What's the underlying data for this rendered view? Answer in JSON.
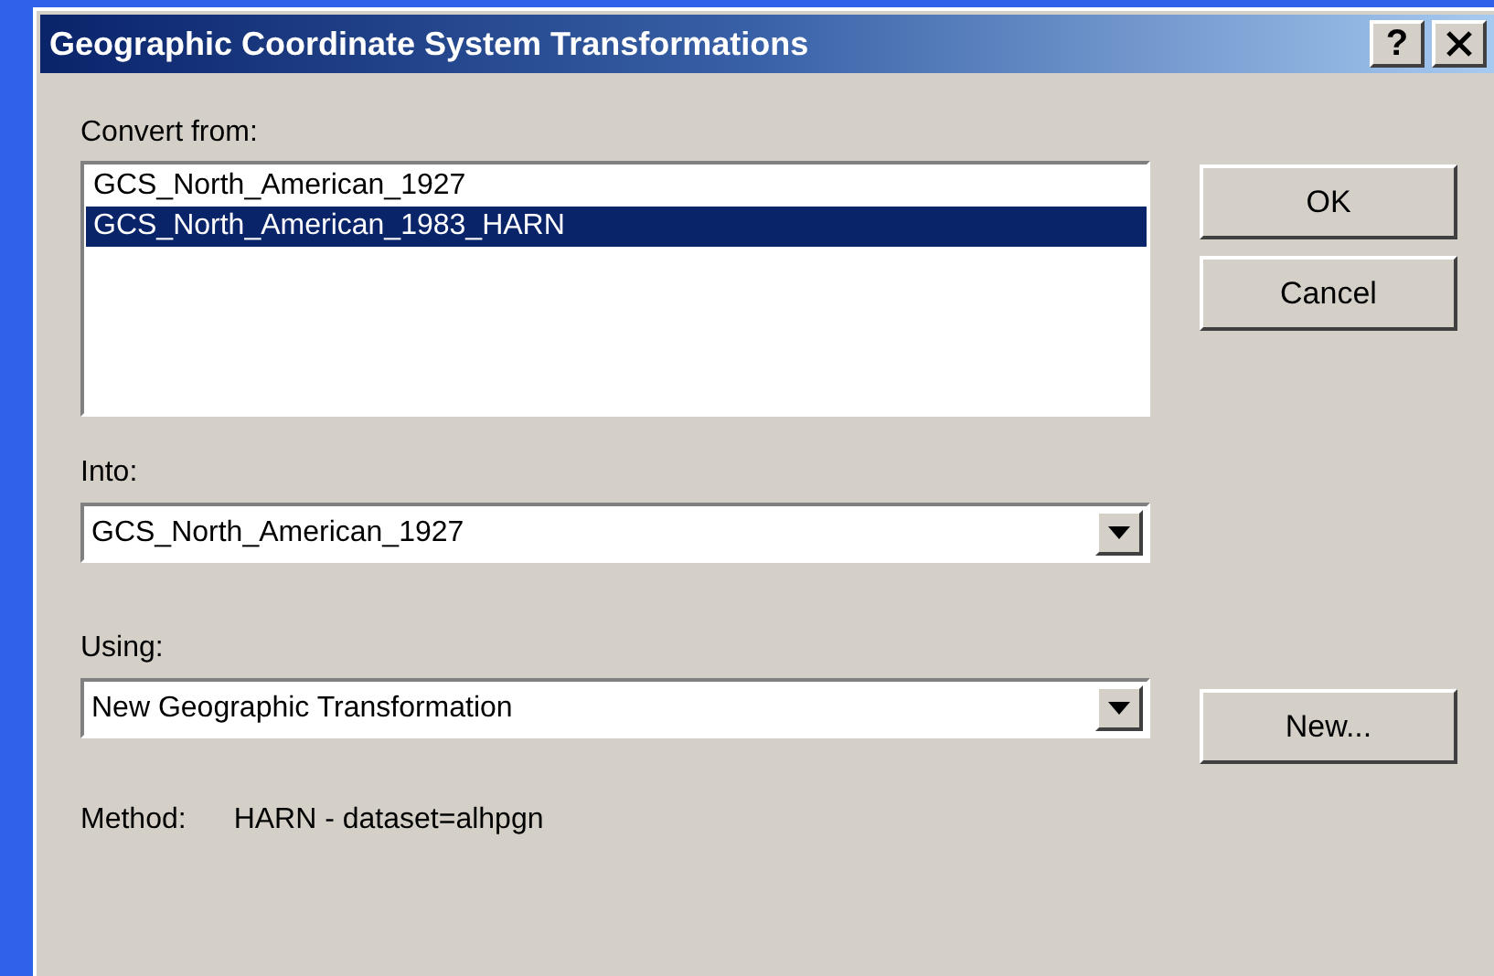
{
  "window": {
    "title": "Geographic Coordinate System Transformations",
    "help_button": "?"
  },
  "convert_from": {
    "label": "Convert from:",
    "items": [
      {
        "text": "GCS_North_American_1927",
        "selected": false
      },
      {
        "text": "GCS_North_American_1983_HARN",
        "selected": true
      }
    ]
  },
  "buttons": [
    "OK",
    "Cancel"
  ],
  "into": {
    "label": "Into:",
    "value": "GCS_North_American_1927"
  },
  "using": {
    "label": "Using:",
    "value": "New Geographic Transformation",
    "button": "New..."
  },
  "method": {
    "label": "Method:",
    "value": "HARN - dataset=alhpgn"
  }
}
